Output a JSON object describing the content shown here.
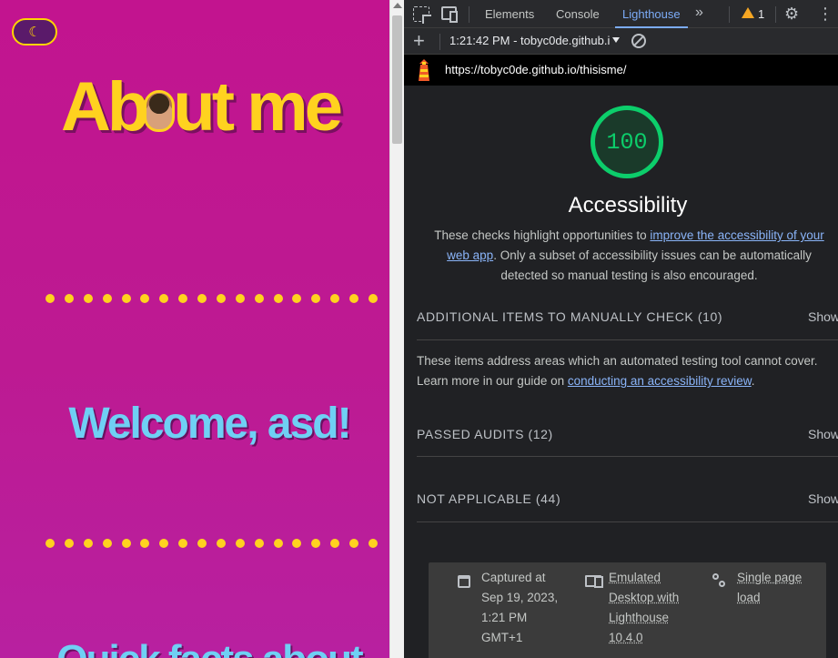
{
  "page": {
    "theme_toggle_icon": "☾",
    "title_part1": "Ab",
    "title_part2": "ut me",
    "welcome": "Welcome, asd!",
    "quick_facts": "Quick facts about",
    "accent_color": "#ffd21f",
    "background_color": "#c2148f"
  },
  "devtools": {
    "tabs": {
      "elements": "Elements",
      "console": "Console",
      "lighthouse": "Lighthouse"
    },
    "more_tabs_icon": "»",
    "warning_count": "1",
    "toolbar": {
      "report_label": "1:21:42 PM - tobyc0de.github.i"
    },
    "url": "https://tobyc0de.github.io/thisisme/",
    "report": {
      "score": "100",
      "score_color": "#0cce6b",
      "category": "Accessibility",
      "description_before": "These checks highlight opportunities to ",
      "description_link": "improve the accessibility of your web app",
      "description_after": ". Only a subset of accessibility issues can be automatically detected so manual testing is also encouraged.",
      "sections": {
        "manual": {
          "title": "ADDITIONAL ITEMS TO MANUALLY CHECK (10)",
          "show": "Show",
          "desc_before": "These items address areas which an automated testing tool cannot cover. Learn more in our guide on ",
          "desc_link": "conducting an accessibility review",
          "desc_after": "."
        },
        "passed": {
          "title": "PASSED AUDITS (12)",
          "show": "Show"
        },
        "not_applicable": {
          "title": "NOT APPLICABLE (44)",
          "show": "Show"
        }
      },
      "footer": {
        "captured": "Captured at Sep 19, 2023, 1:21 PM GMT+1",
        "emulated": "Emulated Desktop with Lighthouse 10.4.0",
        "single_page": "Single page load"
      }
    }
  }
}
